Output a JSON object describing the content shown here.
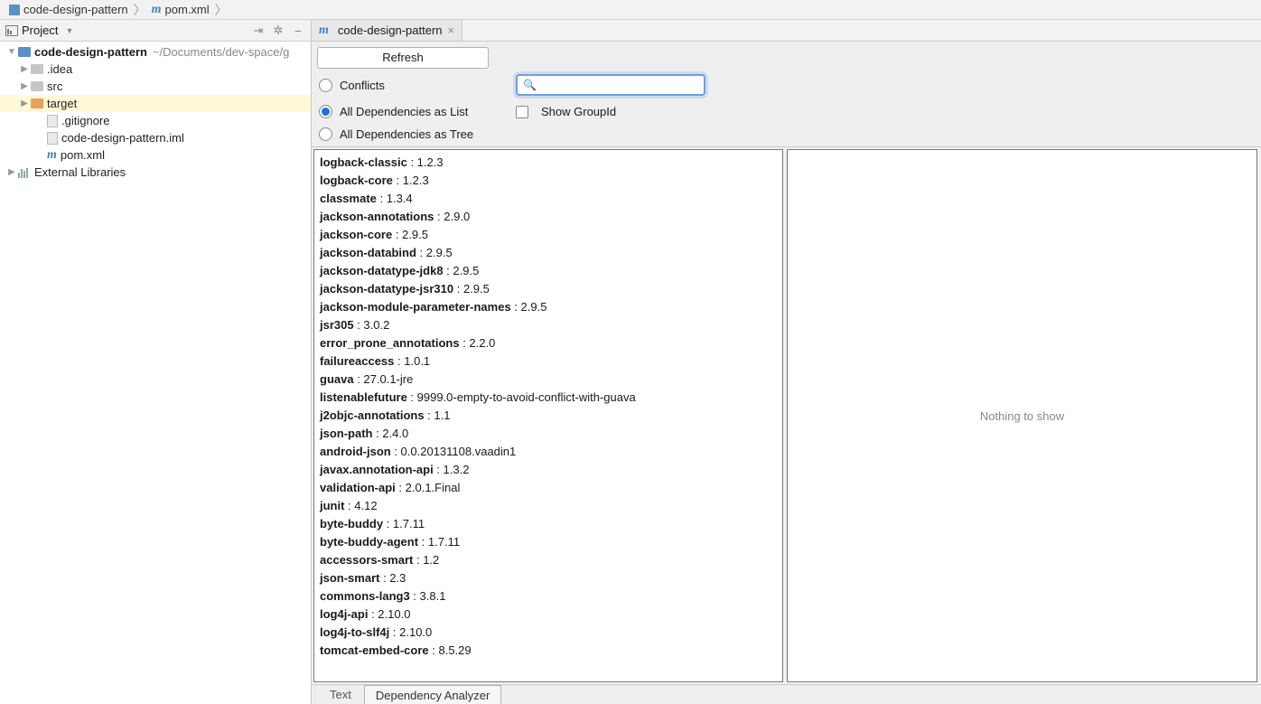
{
  "breadcrumb": {
    "project": "code-design-pattern",
    "file": "pom.xml"
  },
  "sidebar": {
    "title": "Project",
    "tree": {
      "root": {
        "name": "code-design-pattern",
        "path": "~/Documents/dev-space/g"
      },
      "children": [
        {
          "name": ".idea",
          "type": "folder"
        },
        {
          "name": "src",
          "type": "folder"
        },
        {
          "name": "target",
          "type": "folder-selected"
        },
        {
          "name": ".gitignore",
          "type": "file"
        },
        {
          "name": "code-design-pattern.iml",
          "type": "file"
        },
        {
          "name": "pom.xml",
          "type": "maven"
        }
      ],
      "external": "External Libraries"
    }
  },
  "editor_tab": {
    "label": "code-design-pattern"
  },
  "analyzer": {
    "refresh_label": "Refresh",
    "radio_conflicts": "Conflicts",
    "radio_list": "All Dependencies as List",
    "radio_tree": "All Dependencies as Tree",
    "show_groupid": "Show GroupId",
    "search_value": "",
    "nothing": "Nothing to show"
  },
  "dependencies": [
    {
      "name": "logback-classic",
      "ver": "1.2.3"
    },
    {
      "name": "logback-core",
      "ver": "1.2.3"
    },
    {
      "name": "classmate",
      "ver": "1.3.4"
    },
    {
      "name": "jackson-annotations",
      "ver": "2.9.0"
    },
    {
      "name": "jackson-core",
      "ver": "2.9.5"
    },
    {
      "name": "jackson-databind",
      "ver": "2.9.5"
    },
    {
      "name": "jackson-datatype-jdk8",
      "ver": "2.9.5"
    },
    {
      "name": "jackson-datatype-jsr310",
      "ver": "2.9.5"
    },
    {
      "name": "jackson-module-parameter-names",
      "ver": "2.9.5"
    },
    {
      "name": "jsr305",
      "ver": "3.0.2"
    },
    {
      "name": "error_prone_annotations",
      "ver": "2.2.0"
    },
    {
      "name": "failureaccess",
      "ver": "1.0.1"
    },
    {
      "name": "guava",
      "ver": "27.0.1-jre"
    },
    {
      "name": "listenablefuture",
      "ver": "9999.0-empty-to-avoid-conflict-with-guava"
    },
    {
      "name": "j2objc-annotations",
      "ver": "1.1"
    },
    {
      "name": "json-path",
      "ver": "2.4.0"
    },
    {
      "name": "android-json",
      "ver": "0.0.20131108.vaadin1"
    },
    {
      "name": "javax.annotation-api",
      "ver": "1.3.2"
    },
    {
      "name": "validation-api",
      "ver": "2.0.1.Final"
    },
    {
      "name": "junit",
      "ver": "4.12"
    },
    {
      "name": "byte-buddy",
      "ver": "1.7.11"
    },
    {
      "name": "byte-buddy-agent",
      "ver": "1.7.11"
    },
    {
      "name": "accessors-smart",
      "ver": "1.2"
    },
    {
      "name": "json-smart",
      "ver": "2.3"
    },
    {
      "name": "commons-lang3",
      "ver": "3.8.1"
    },
    {
      "name": "log4j-api",
      "ver": "2.10.0"
    },
    {
      "name": "log4j-to-slf4j",
      "ver": "2.10.0"
    },
    {
      "name": "tomcat-embed-core",
      "ver": "8.5.29"
    }
  ],
  "bottom": {
    "text": "Text",
    "analyzer": "Dependency Analyzer"
  }
}
